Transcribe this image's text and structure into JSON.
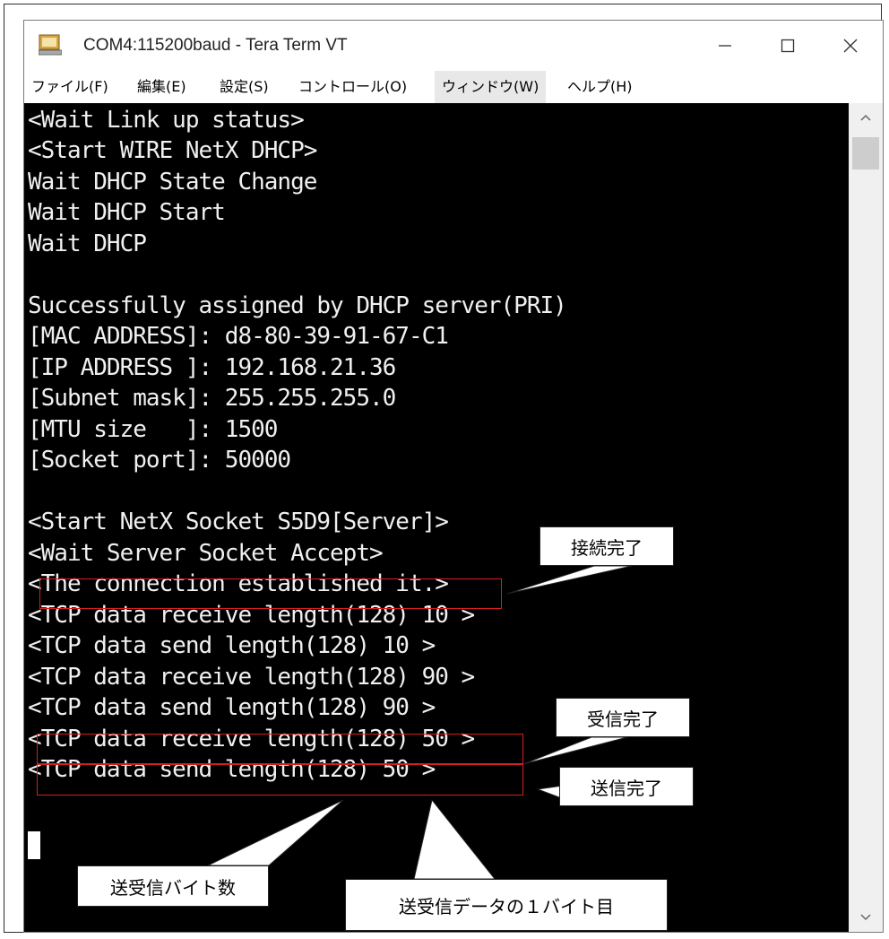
{
  "window": {
    "title": "COM4:115200baud - Tera Term VT",
    "controls": {
      "minimize_glyph": "—",
      "maximize_glyph": "□",
      "close_glyph": "✕"
    }
  },
  "menu": {
    "items": [
      {
        "label": "ファイル(F)"
      },
      {
        "label": "編集(E)"
      },
      {
        "label": "設定(S)"
      },
      {
        "label": "コントロール(O)"
      },
      {
        "label": "ウィンドウ(W)"
      },
      {
        "label": "ヘルプ(H)"
      }
    ]
  },
  "terminal": {
    "lines": [
      "<Wait Link up status>",
      "<Start WIRE NetX DHCP>",
      "Wait DHCP State Change",
      "Wait DHCP Start",
      "Wait DHCP",
      "",
      "Successfully assigned by DHCP server(PRI)",
      "[MAC ADDRESS]: d8-80-39-91-67-C1",
      "[IP ADDRESS ]: 192.168.21.36",
      "[Subnet mask]: 255.255.255.0",
      "[MTU size   ]: 1500",
      "[Socket port]: 50000",
      "",
      "<Start NetX Socket S5D9[Server]>",
      "<Wait Server Socket Accept>",
      "<The connection established it.>",
      "<TCP data receive length(128) 10 >",
      "<TCP data send length(128) 10 >",
      "<TCP data receive length(128) 90 >",
      "<TCP data send length(128) 90 >",
      "<TCP data receive length(128) 50 >",
      "<TCP data send length(128) 50 >"
    ]
  },
  "annotations": {
    "connection_complete": "接続完了",
    "receive_complete": "受信完了",
    "send_complete": "送信完了",
    "byte_count": "送受信バイト数",
    "first_byte": "送受信データの１バイト目"
  },
  "colors": {
    "terminal_bg": "#000000",
    "terminal_fg": "#f0f0f0",
    "highlight": "#d41f1f"
  },
  "icons": {
    "app": "teraterm-icon",
    "scroll_up": "chevron-up-icon",
    "scroll_down": "chevron-down-icon"
  }
}
